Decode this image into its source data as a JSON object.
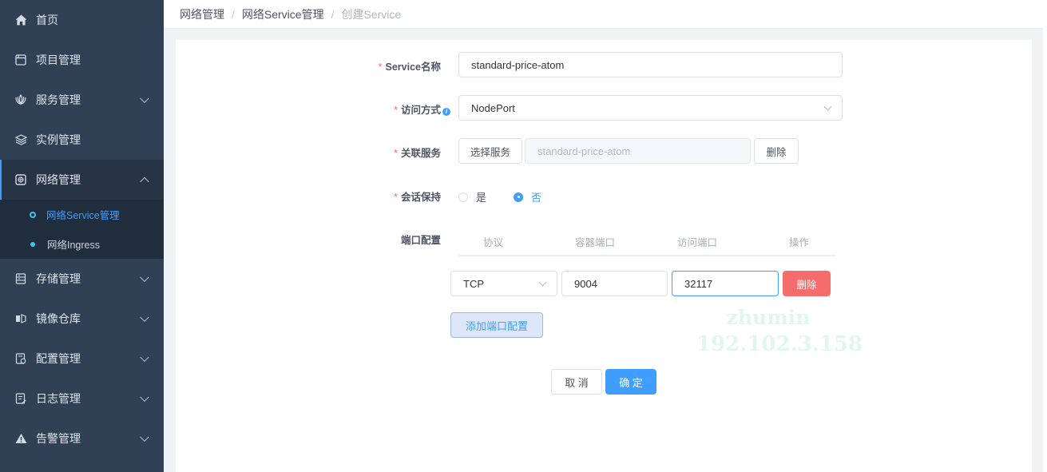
{
  "sidebar": {
    "items": [
      {
        "label": "首页",
        "icon": "home-icon"
      },
      {
        "label": "项目管理",
        "icon": "project-icon"
      },
      {
        "label": "服务管理",
        "icon": "service-icon"
      },
      {
        "label": "实例管理",
        "icon": "layers-icon"
      },
      {
        "label": "网络管理",
        "icon": "network-icon"
      },
      {
        "label": "存储管理",
        "icon": "storage-icon"
      },
      {
        "label": "镜像仓库",
        "icon": "image-repo-icon"
      },
      {
        "label": "配置管理",
        "icon": "config-icon"
      },
      {
        "label": "日志管理",
        "icon": "log-icon"
      },
      {
        "label": "告警管理",
        "icon": "warning-icon"
      }
    ],
    "network_submenu": [
      {
        "label": "网络Service管理",
        "active": true
      },
      {
        "label": "网络Ingress",
        "active": false
      }
    ]
  },
  "breadcrumb": [
    "网络管理",
    "网络Service管理",
    "创建Service"
  ],
  "breadcrumb_separator": "/",
  "form": {
    "service_name": {
      "label": "Service名称",
      "value": "standard-price-atom"
    },
    "access_mode": {
      "label": "访问方式",
      "value": "NodePort",
      "info_icon": "i"
    },
    "related_service": {
      "label": "关联服务",
      "select_button": "选择服务",
      "value": "standard-price-atom",
      "delete_button": "删除"
    },
    "session_affinity": {
      "label": "会话保持",
      "options": [
        "是",
        "否"
      ],
      "selected": "否"
    },
    "port_config": {
      "label": "端口配置",
      "columns": [
        "协议",
        "容器端口",
        "访问端口",
        "操作"
      ],
      "rows": [
        {
          "protocol": "TCP",
          "container_port": "9004",
          "access_port": "32117",
          "action": "删除"
        }
      ],
      "add_button": "添加端口配置"
    },
    "required_mark": "*",
    "cancel_button": "取 消",
    "confirm_button": "确 定"
  },
  "watermark": {
    "line1": "zhumin",
    "line2": "192.102.3.158"
  },
  "colors": {
    "sidebar_bg": "#304156",
    "primary": "#409eff",
    "danger": "#f56c6c"
  }
}
